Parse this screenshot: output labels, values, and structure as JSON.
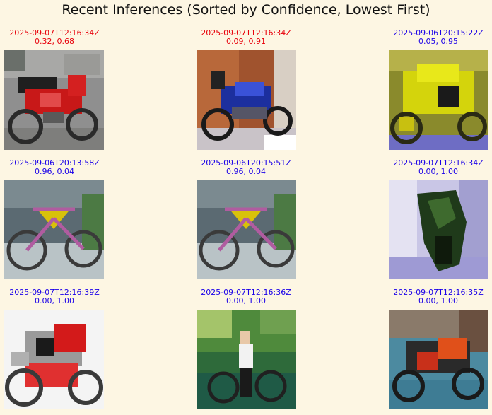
{
  "page": {
    "title": "Recent Inferences (Sorted by Confidence, Lowest First)"
  },
  "colors": {
    "background": "#fdf6e3",
    "misclassified": "#e8000b",
    "correct": "#1a00e8"
  },
  "inferences": [
    {
      "timestamp": "2025-09-07T12:16:34Z",
      "scores": "0.32, 0.68",
      "status": "misclassified",
      "image": "red motorcycle on pavement"
    },
    {
      "timestamp": "2025-09-07T12:16:34Z",
      "scores": "0.09, 0.91",
      "status": "misclassified",
      "image": "blue motorcycle by brick wall"
    },
    {
      "timestamp": "2025-09-06T20:15:22Z",
      "scores": "0.05, 0.95",
      "status": "correct",
      "image": "yellow sport motorcycle"
    },
    {
      "timestamp": "2025-09-06T20:13:58Z",
      "scores": "0.96, 0.04",
      "status": "correct",
      "image": "bicycle with yellow frame bag"
    },
    {
      "timestamp": "2025-09-06T20:15:51Z",
      "scores": "0.96, 0.04",
      "status": "correct",
      "image": "bicycle with yellow frame bag"
    },
    {
      "timestamp": "2025-09-07T12:16:34Z",
      "scores": "0.00, 1.00",
      "status": "correct",
      "image": "dark green motorcycle close-up"
    },
    {
      "timestamp": "2025-09-07T12:16:39Z",
      "scores": "0.00, 1.00",
      "status": "correct",
      "image": "red and white sport motorcycle"
    },
    {
      "timestamp": "2025-09-07T12:16:36Z",
      "scores": "0.00, 1.00",
      "status": "correct",
      "image": "person riding bicycle in park"
    },
    {
      "timestamp": "2025-09-07T12:16:35Z",
      "scores": "0.00, 1.00",
      "status": "correct",
      "image": "orange motorcycle on street"
    }
  ]
}
